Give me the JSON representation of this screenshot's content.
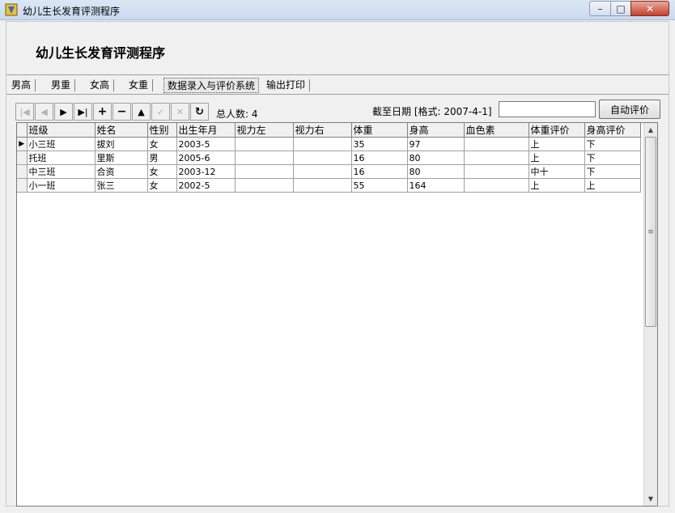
{
  "window": {
    "title": "幼儿生长发育评测程序",
    "min": "–",
    "max": "□",
    "close": "✕"
  },
  "header": {
    "heading": "幼儿生长发育评测程序"
  },
  "tabs": [
    "男高",
    "男重",
    "女高",
    "女重",
    "数据录入与评价系统",
    "输出打印"
  ],
  "active_tab": "数据录入与评价系统",
  "navigator": {
    "first": "|◀",
    "prior": "◀",
    "next": "▶",
    "last": "▶|",
    "insert": "+",
    "delete": "−",
    "edit": "▲",
    "post": "✓",
    "cancel": "✕",
    "refresh": "↻",
    "total_label": "总人数: 4"
  },
  "date": {
    "label": "截至日期 [格式: 2007-4-1]",
    "value": ""
  },
  "auto_button": "自动评价",
  "grid": {
    "columns": [
      "班级",
      "姓名",
      "性别",
      "出生年月",
      "视力左",
      "视力右",
      "体重",
      "身高",
      "血色素",
      "体重评价",
      "身高评价"
    ],
    "current_row_marker": "▶",
    "rows": [
      [
        "小三班",
        "拔刘",
        "女",
        "2003-5",
        "",
        "",
        "35",
        "97",
        "",
        "上",
        "下"
      ],
      [
        "托班",
        "里斯",
        "男",
        "2005-6",
        "",
        "",
        "16",
        "80",
        "",
        "上",
        "下"
      ],
      [
        "中三班",
        "合资",
        "女",
        "2003-12",
        "",
        "",
        "16",
        "80",
        "",
        "中十",
        "下"
      ],
      [
        "小一班",
        "张三",
        "女",
        "2002-5",
        "",
        "",
        "55",
        "164",
        "",
        "上",
        "上"
      ]
    ]
  },
  "scrollbar": {
    "up": "▲",
    "down": "▼",
    "grip": "≡"
  }
}
